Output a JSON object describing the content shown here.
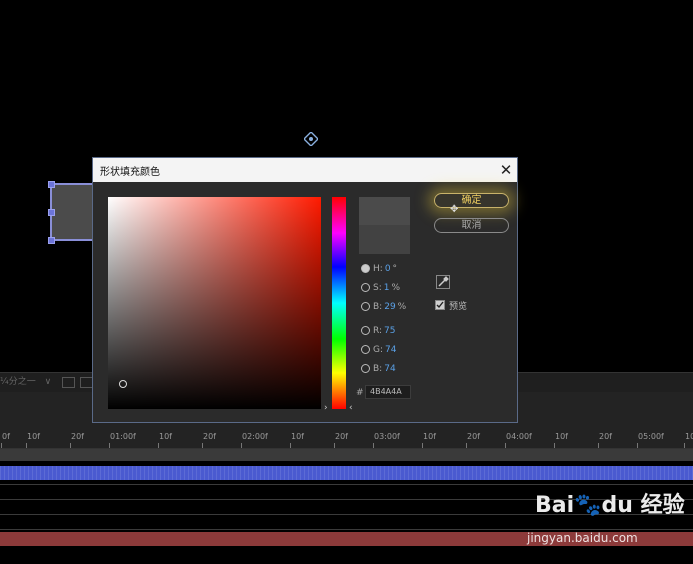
{
  "dialog": {
    "title": "形状填充颜色",
    "close_glyph": "✕",
    "ok_label": "确定",
    "cancel_label": "取消",
    "preview_label": "预览",
    "preview_checked": true,
    "hex_prefix": "#",
    "hex_value": "4B4A4A",
    "new_color": "#4b4b4b",
    "old_color": "#424242",
    "fields": [
      {
        "key": "H",
        "label": "H:",
        "value": "0",
        "unit": "°",
        "selected": true
      },
      {
        "key": "S",
        "label": "S:",
        "value": "1",
        "unit": "%",
        "selected": false
      },
      {
        "key": "B",
        "label": "B:",
        "value": "29",
        "unit": "%",
        "selected": false
      },
      {
        "key": "R",
        "label": "R:",
        "value": "75",
        "unit": "",
        "selected": false
      },
      {
        "key": "G",
        "label": "G:",
        "value": "74",
        "unit": "",
        "selected": false
      },
      {
        "key": "Bl",
        "label": "B:",
        "value": "74",
        "unit": "",
        "selected": false
      }
    ],
    "icons": [
      "close-icon",
      "eyedropper-icon",
      "checkbox-icon",
      "hue-slider-arrow-icon",
      "mouse-cursor-icon"
    ]
  },
  "viewer": {
    "zoom_text": "¼分之一",
    "dropdown_glyph": "∨",
    "icons": [
      "anchor-point-icon",
      "layer-rect"
    ]
  },
  "timeline": {
    "ruler_labels": [
      "0f",
      "10f",
      "20f",
      "01:00f",
      "10f",
      "20f",
      "02:00f",
      "10f",
      "20f",
      "03:00f",
      "10f",
      "20f",
      "04:00f",
      "10f",
      "20f",
      "05:00f",
      "10"
    ]
  },
  "watermark": {
    "logo_text": "Bai🐾du 经验",
    "url": "jingyan.baidu.com"
  },
  "colors": {
    "accent_ok": "#f0d060",
    "value_text": "#5aa0e6",
    "track_blue": "#4a5ad0",
    "track_red": "#8c3a3a"
  }
}
